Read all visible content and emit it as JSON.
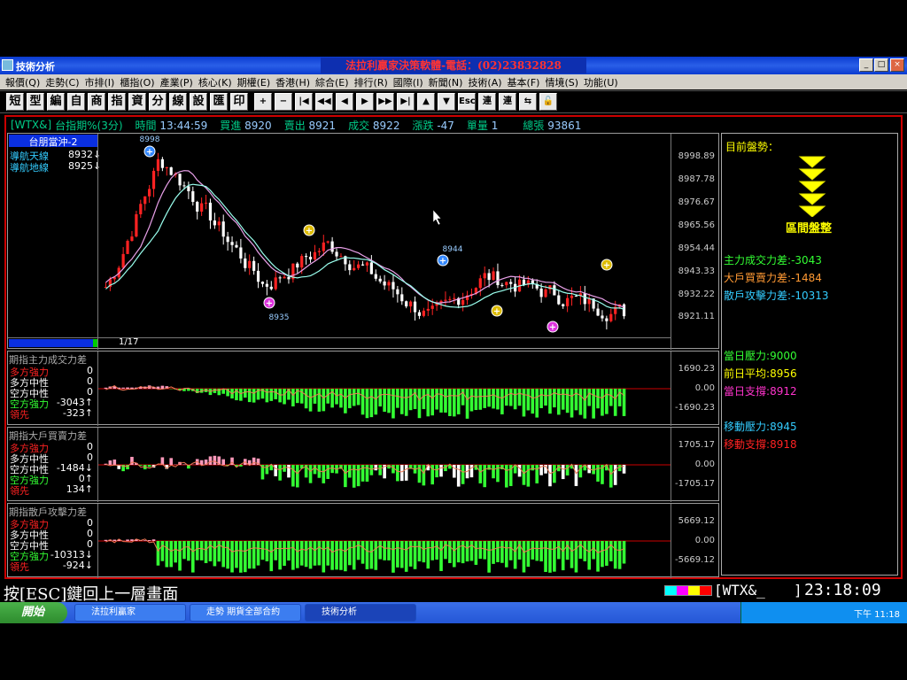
{
  "window": {
    "title": "技術分析",
    "banner": "法拉利贏家決策軟體-電話：(02)23832828",
    "controls": [
      "_",
      "□",
      "×"
    ]
  },
  "menu": [
    "報價(Q)",
    "走勢(C)",
    "市排(I)",
    "櫃指(O)",
    "產業(P)",
    "核心(K)",
    "期權(E)",
    "香港(H)",
    "綜合(E)",
    "排行(R)",
    "國際(I)",
    "新聞(N)",
    "技術(A)",
    "基本(F)",
    "情境(S)",
    "功能(U)"
  ],
  "toolbar": {
    "text_buttons": [
      "短",
      "型",
      "編",
      "自",
      "商",
      "指",
      "資",
      "分",
      "線",
      "設",
      "匯",
      "印"
    ],
    "nav_buttons": [
      "+",
      "−",
      "|◀",
      "◀◀",
      "◀",
      "▶",
      "▶▶",
      "▶|",
      "▲",
      "▼",
      "Esc",
      "連",
      "連",
      "⇆",
      "🔓"
    ]
  },
  "quote": {
    "symbol": "[WTX&]",
    "name": "台指期%(3分)",
    "time_label": "時間",
    "time": "13:44:59",
    "bid_label": "買進",
    "bid": "8920",
    "ask_label": "賣出",
    "ask": "8921",
    "trade_label": "成交",
    "trade": "8922",
    "change_label": "漲跌",
    "change": "-47",
    "volume_label": "單量",
    "volume": "1",
    "total_label": "總張",
    "total": "93861"
  },
  "price_panel": {
    "indicator_title": "台朋當沖-2",
    "lines": [
      {
        "label": "導航天線",
        "value": "8932↓"
      },
      {
        "label": "導航地線",
        "value": "8925↓"
      }
    ],
    "page": "1/17",
    "y_ticks": [
      "8998.89",
      "8987.78",
      "8976.67",
      "8965.56",
      "8954.44",
      "8943.33",
      "8932.22",
      "8921.11"
    ],
    "marks": {
      "high": "8998",
      "low": "8935",
      "mid": "8944"
    }
  },
  "sub_panels": [
    {
      "title": "期指主力成交力差",
      "rows": [
        {
          "label": "多方強力",
          "value": "0"
        },
        {
          "label": "多方中性",
          "value": "0"
        },
        {
          "label": "空方中性",
          "value": "0"
        },
        {
          "label": "空方強力",
          "value": "-3043↑"
        },
        {
          "label": "領先",
          "value": "-323↑"
        }
      ],
      "y_ticks": [
        "1690.23",
        "0.00",
        "-1690.23"
      ]
    },
    {
      "title": "期指大戶買賣力差",
      "rows": [
        {
          "label": "多方強力",
          "value": "0"
        },
        {
          "label": "多方中性",
          "value": "0"
        },
        {
          "label": "空方中性",
          "value": "-1484↓"
        },
        {
          "label": "空方強力",
          "value": "0↑"
        },
        {
          "label": "領先",
          "value": "134↑"
        }
      ],
      "y_ticks": [
        "1705.17",
        "0.00",
        "-1705.17"
      ]
    },
    {
      "title": "期指散戶攻擊力差",
      "rows": [
        {
          "label": "多方強力",
          "value": "0"
        },
        {
          "label": "多方中性",
          "value": "0"
        },
        {
          "label": "空方中性",
          "value": "0"
        },
        {
          "label": "空方強力",
          "value": "-10313↓"
        },
        {
          "label": "領先",
          "value": "-924↓"
        }
      ],
      "y_ticks": [
        "5669.12",
        "0.00",
        "-5669.12"
      ]
    }
  ],
  "right_panel": {
    "market_label": "目前盤勢：",
    "market_state": "區間盤整",
    "forces": [
      {
        "label": "主力成交力差",
        "value": "-3043"
      },
      {
        "label": "大戶買賣力差",
        "value": "-1484"
      },
      {
        "label": "散戶攻擊力差",
        "value": "-10313"
      }
    ],
    "levels": [
      {
        "label": "當日壓力",
        "value": "9000"
      },
      {
        "label": "前日平均",
        "value": "8956"
      },
      {
        "label": "當日支撐",
        "value": "8912"
      }
    ],
    "moving": [
      {
        "label": "移動壓力",
        "value": "8945"
      },
      {
        "label": "移動支撐",
        "value": "8918"
      }
    ]
  },
  "status": {
    "esc_hint": "按[ESC]鍵回上一層畫面",
    "symbol_box": "[WTX&_",
    "bracket": "]",
    "clock": "23:18:09"
  },
  "taskbar": {
    "start": "開始",
    "tasks": [
      "法拉利贏家",
      "走勢 期貨全部合約",
      "技術分析"
    ],
    "tray_time": "下午 11:18"
  },
  "colors": {
    "up": "#ff2020",
    "down": "#33ff33",
    "accent": "#0a3bd0",
    "frame": "#cc0000"
  }
}
